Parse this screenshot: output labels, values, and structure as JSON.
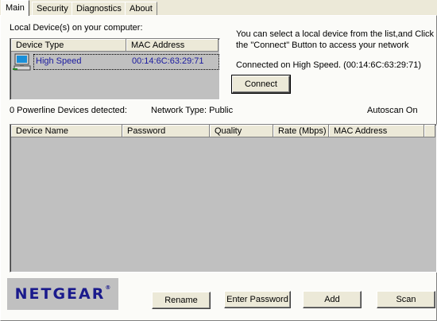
{
  "tabs": [
    "Main",
    "Security",
    "Diagnostics",
    "About"
  ],
  "local_devices": {
    "label": "Local Device(s) on your computer:",
    "columns": [
      "Device Type",
      "MAC Address"
    ],
    "rows": [
      {
        "type": "High Speed",
        "mac": "00:14:6C:63:29:71"
      }
    ]
  },
  "info": {
    "line1": "You can select a local device from the list,and Click",
    "line2": "the \"Connect\" Button to access your network",
    "connected": "Connected on  High Speed. (00:14:6C:63:29:71)"
  },
  "buttons": {
    "connect": "Connect",
    "rename": "Rename",
    "enter_password": "Enter Password",
    "add": "Add",
    "scan": "Scan"
  },
  "status": {
    "detected": "0 Powerline Devices detected:",
    "network_type": "Network Type: Public",
    "autoscan": "Autoscan On"
  },
  "device_table": {
    "columns": [
      "Device Name",
      "Password",
      "Quality",
      "Rate (Mbps)",
      "MAC Address"
    ],
    "rows": []
  },
  "logo": {
    "text": "NETGEAR",
    "mark": "®"
  },
  "colors": {
    "list_bg": "#c0c0c0",
    "logo_text": "#1a1a8c",
    "selected_text": "#1a1aa0"
  }
}
